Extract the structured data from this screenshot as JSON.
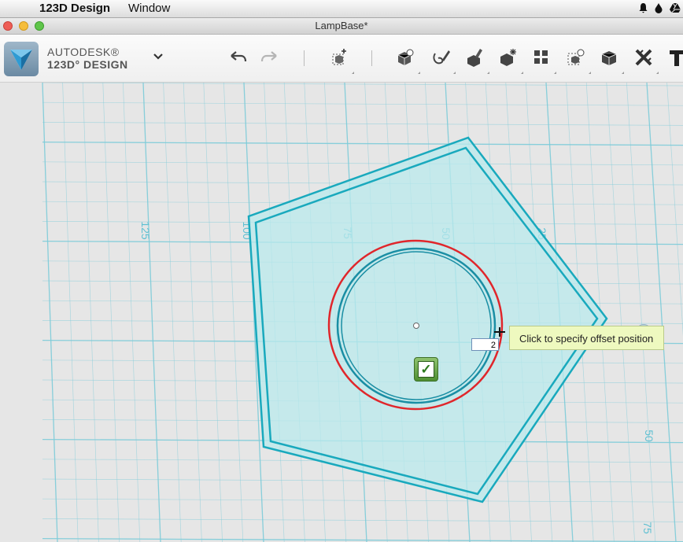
{
  "menubar": {
    "apple_glyph": "",
    "app_name": "123D Design",
    "menu_window": "Window"
  },
  "window": {
    "title": "LampBase*"
  },
  "branding": {
    "line1": "AUTODESK®",
    "line2": "123D° DESIGN"
  },
  "grid": {
    "labels": [
      "125",
      "100",
      "75",
      "50",
      "25",
      "50",
      "75"
    ]
  },
  "offset": {
    "value": "2",
    "tooltip": "Click to specify offset position"
  },
  "colors": {
    "shape_stroke": "#19a9bd",
    "shape_fill": "#b9e9ec",
    "grid_line": "#7ccbd8",
    "selection_circle": "#e0262b"
  }
}
